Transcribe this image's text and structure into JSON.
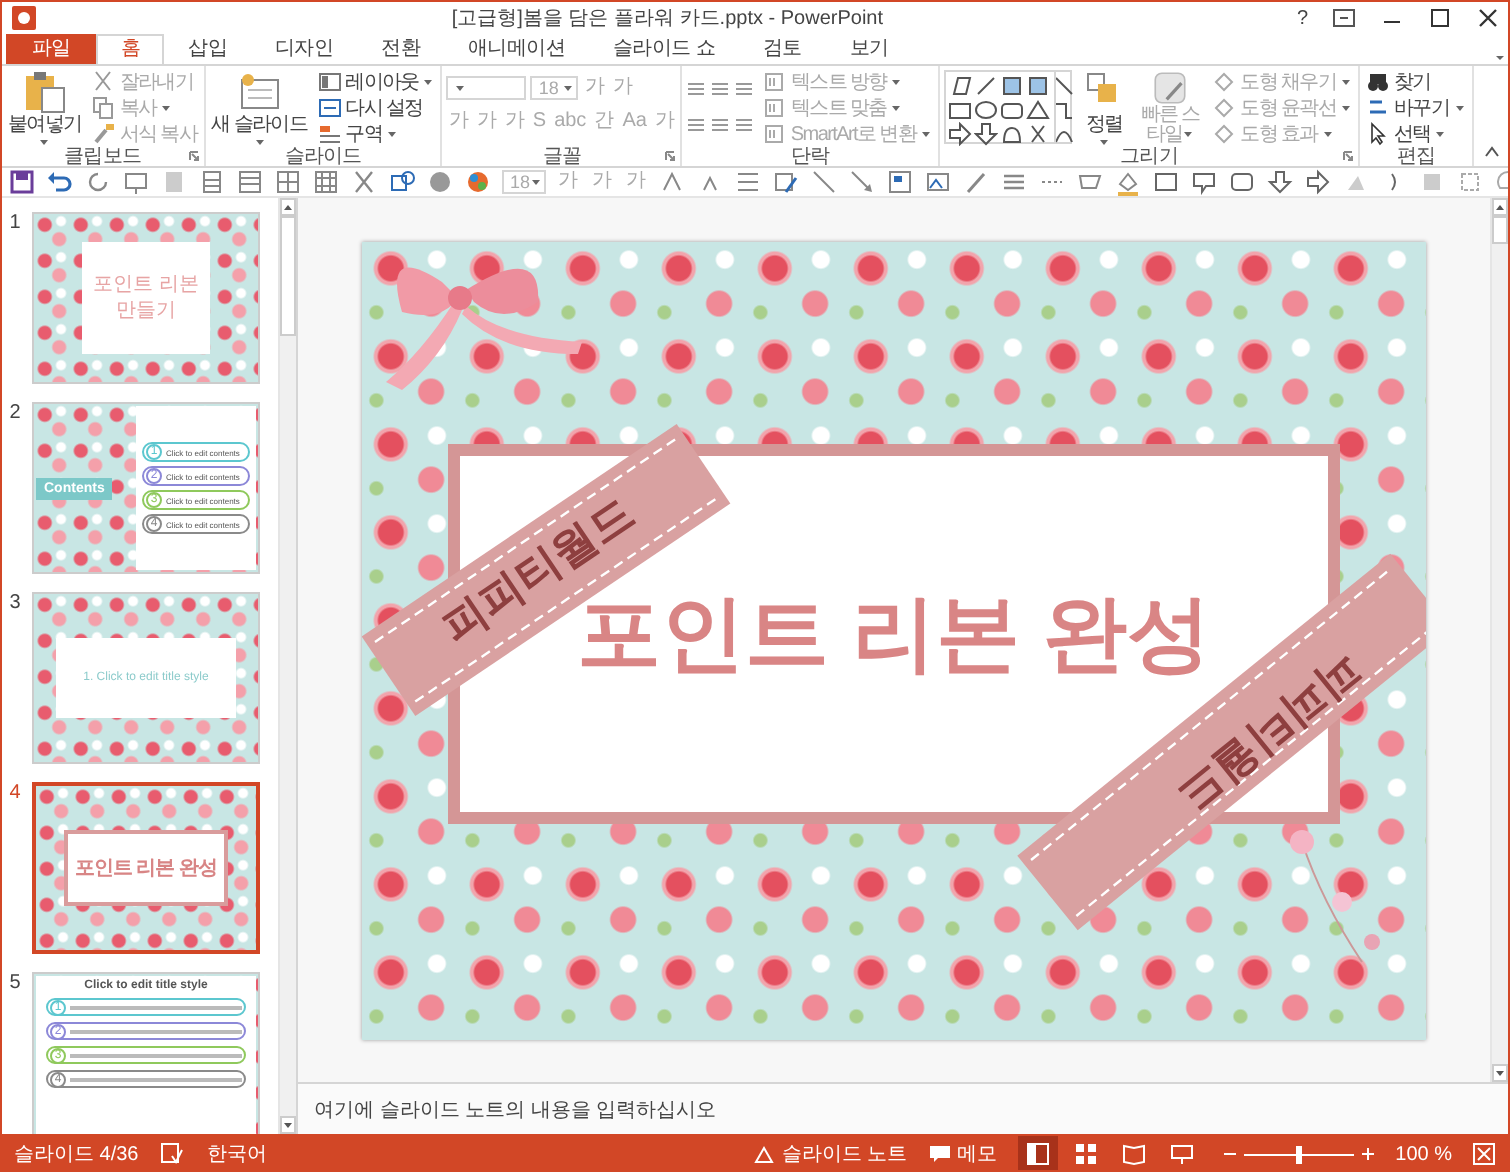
{
  "window": {
    "title": "[고급형]봄을 담은 플라워 카드.pptx - PowerPoint",
    "help": "?"
  },
  "tabs": [
    {
      "label": "파일",
      "kind": "file",
      "selected": false
    },
    {
      "label": "홈",
      "kind": "tab",
      "selected": true
    },
    {
      "label": "삽입",
      "kind": "tab",
      "selected": false
    },
    {
      "label": "디자인",
      "kind": "tab",
      "selected": false
    },
    {
      "label": "전환",
      "kind": "tab",
      "selected": false
    },
    {
      "label": "애니메이션",
      "kind": "tab",
      "selected": false
    },
    {
      "label": "슬라이드 쇼",
      "kind": "tab",
      "selected": false
    },
    {
      "label": "검토",
      "kind": "tab",
      "selected": false
    },
    {
      "label": "보기",
      "kind": "tab",
      "selected": false
    }
  ],
  "ribbon": {
    "groups": [
      {
        "kind": "clipboard",
        "label": "클립보드",
        "launcher": true,
        "main": {
          "label": "붙여넣기",
          "disabled": false,
          "dropdown": true
        },
        "items": [
          {
            "label": "잘라내기",
            "disabled": true,
            "dropdown": false
          },
          {
            "label": "복사",
            "disabled": true,
            "dropdown": true
          },
          {
            "label": "서식 복사",
            "disabled": true,
            "dropdown": false
          }
        ]
      },
      {
        "kind": "slides",
        "label": "슬라이드",
        "main": {
          "label": "새 슬라이드",
          "disabled": false,
          "dropdown": true
        },
        "items": [
          {
            "label": "레이아웃",
            "disabled": false,
            "dropdown": true
          },
          {
            "label": "다시 설정",
            "disabled": false,
            "dropdown": false
          },
          {
            "label": "구역",
            "disabled": false,
            "dropdown": true
          }
        ]
      },
      {
        "kind": "font",
        "label": "글꼴",
        "launcher": true,
        "font_size": "18",
        "grow": [
          "가",
          "가"
        ],
        "styles": [
          "가",
          "가",
          "가",
          "S",
          "abc",
          "간",
          "Aa",
          "가"
        ]
      },
      {
        "kind": "paragraph",
        "label": "단락",
        "items": [
          {
            "label": "텍스트 방향",
            "disabled": true,
            "dropdown": true
          },
          {
            "label": "텍스트 맞춤",
            "disabled": true,
            "dropdown": true
          },
          {
            "label": "SmartArt로 변환",
            "disabled": true,
            "dropdown": true
          }
        ]
      },
      {
        "kind": "drawing",
        "label": "그리기",
        "launcher": true,
        "buttons": [
          {
            "label": "정렬",
            "disabled": false,
            "dropdown": true
          },
          {
            "label": "빠른 스타일",
            "disabled": true,
            "dropdown": true
          }
        ],
        "items": [
          {
            "label": "도형 채우기",
            "disabled": true,
            "dropdown": true
          },
          {
            "label": "도형 윤곽선",
            "disabled": true,
            "dropdown": true
          },
          {
            "label": "도형 효과",
            "disabled": true,
            "dropdown": true
          }
        ]
      },
      {
        "kind": "editing",
        "label": "편집",
        "items": [
          {
            "label": "찾기",
            "disabled": false,
            "dropdown": false
          },
          {
            "label": "바꾸기",
            "disabled": false,
            "dropdown": true
          },
          {
            "label": "선택",
            "disabled": false,
            "dropdown": true
          }
        ]
      }
    ]
  },
  "quick_toolbar": {
    "font_size": "18",
    "glyphs": [
      "가",
      "가",
      "가"
    ]
  },
  "slides": [
    {
      "number": "1",
      "selected": false,
      "kind": "title",
      "title": "포인트 리본 만들기"
    },
    {
      "number": "2",
      "selected": false,
      "kind": "contents",
      "title": "Contents",
      "items": [
        {
          "number": "1",
          "text": "Click to edit contents",
          "color": "#5cc7cf"
        },
        {
          "number": "2",
          "text": "Click to edit contents",
          "color": "#8c88d8"
        },
        {
          "number": "3",
          "text": "Click to edit contents",
          "color": "#8fc95c"
        },
        {
          "number": "4",
          "text": "Click to edit contents",
          "color": "#8a8a8a"
        }
      ]
    },
    {
      "number": "3",
      "selected": false,
      "kind": "section",
      "title": "1. Click to edit title style"
    },
    {
      "number": "4",
      "selected": true,
      "kind": "ribbon",
      "title": "포인트 리본 완성"
    },
    {
      "number": "5",
      "selected": false,
      "kind": "list",
      "title": "Click to edit title style",
      "items": [
        {
          "number": "1",
          "color": "#5cc7cf"
        },
        {
          "number": "2",
          "color": "#8c88d8"
        },
        {
          "number": "3",
          "color": "#8fc95c"
        },
        {
          "number": "4",
          "color": "#8a8a8a"
        }
      ]
    }
  ],
  "slide": {
    "title": "포인트 리본 완성",
    "ribbon_texts": [
      "피피티월드",
      "피피티월드"
    ]
  },
  "notes": {
    "placeholder": "여기에 슬라이드 노트의 내용을 입력하십시오"
  },
  "status_bar": {
    "slide_info": "슬라이드 4/36",
    "language": "한국어",
    "notes_button": "슬라이드 노트",
    "comments_button": "메모",
    "views": [
      {
        "selected": true
      },
      {
        "selected": false
      },
      {
        "selected": false
      },
      {
        "selected": false
      }
    ],
    "zoom": {
      "level": 0.5,
      "reading": "100 %"
    }
  }
}
